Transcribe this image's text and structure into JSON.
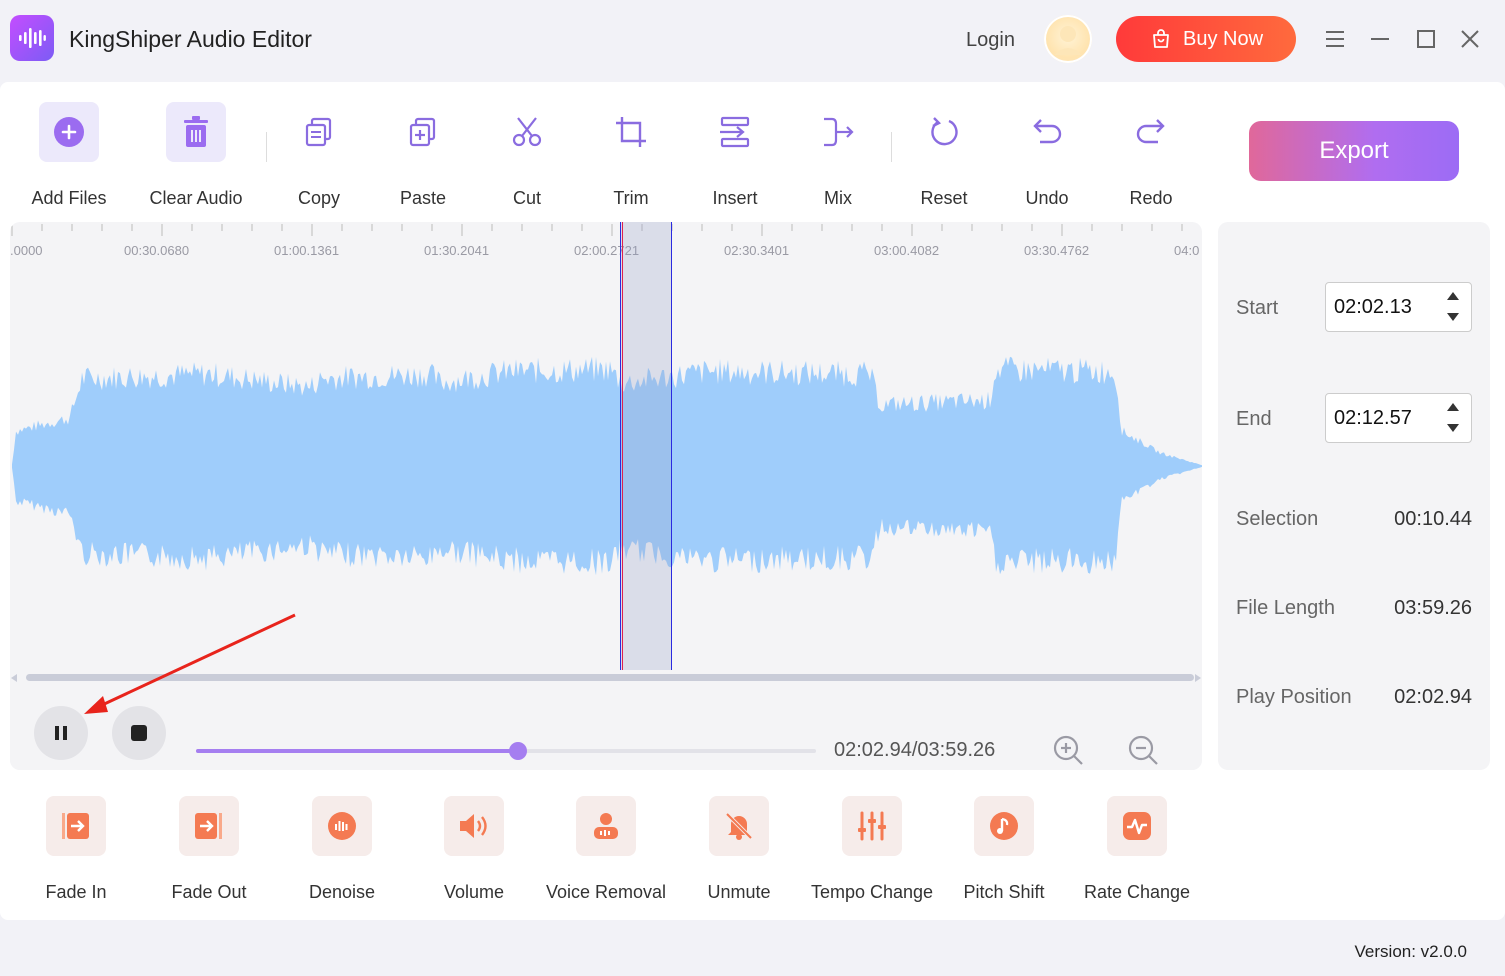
{
  "app": {
    "title": "KingShiper Audio Editor",
    "login": "Login",
    "buy_now": "Buy Now",
    "version": "Version: v2.0.0"
  },
  "toolbar": {
    "items": [
      {
        "label": "Add Files",
        "icon": "add-icon"
      },
      {
        "label": "Clear Audio",
        "icon": "trash-icon"
      },
      {
        "label": "Copy",
        "icon": "copy-icon"
      },
      {
        "label": "Paste",
        "icon": "paste-icon"
      },
      {
        "label": "Cut",
        "icon": "scissors-icon"
      },
      {
        "label": "Trim",
        "icon": "crop-icon"
      },
      {
        "label": "Insert",
        "icon": "insert-icon"
      },
      {
        "label": "Mix",
        "icon": "mix-icon"
      },
      {
        "label": "Reset",
        "icon": "reset-icon"
      },
      {
        "label": "Undo",
        "icon": "undo-icon"
      },
      {
        "label": "Redo",
        "icon": "redo-icon"
      }
    ],
    "export": "Export"
  },
  "ruler": {
    "labels": [
      ".0000",
      "00:30.0680",
      "01:00.1361",
      "01:30.2041",
      "02:00.2721",
      "02:30.3401",
      "03:00.4082",
      "03:30.4762",
      "04:0"
    ]
  },
  "transport": {
    "time": "02:02.94/03:59.26",
    "progress": 0.52
  },
  "info": {
    "start_label": "Start",
    "start_value": "02:02.13",
    "end_label": "End",
    "end_value": "02:12.57",
    "selection_label": "Selection",
    "selection_value": "00:10.44",
    "length_label": "File Length",
    "length_value": "03:59.26",
    "position_label": "Play Position",
    "position_value": "02:02.94"
  },
  "effects": {
    "items": [
      {
        "label": "Fade In",
        "icon": "fade-in-icon"
      },
      {
        "label": "Fade Out",
        "icon": "fade-out-icon"
      },
      {
        "label": "Denoise",
        "icon": "denoise-icon"
      },
      {
        "label": "Volume",
        "icon": "speaker-icon"
      },
      {
        "label": "Voice Removal",
        "icon": "voice-removal-icon"
      },
      {
        "label": "Unmute",
        "icon": "bell-mute-icon"
      },
      {
        "label": "Tempo Change",
        "icon": "sliders-icon"
      },
      {
        "label": "Pitch Shift",
        "icon": "music-note-icon"
      },
      {
        "label": "Rate Change",
        "icon": "pulse-icon"
      }
    ]
  },
  "colors": {
    "accent": "#a57ef0",
    "waveform": "#9fcdfb",
    "buy": "#ff4a3a",
    "effect_icon": "#f2714f"
  }
}
